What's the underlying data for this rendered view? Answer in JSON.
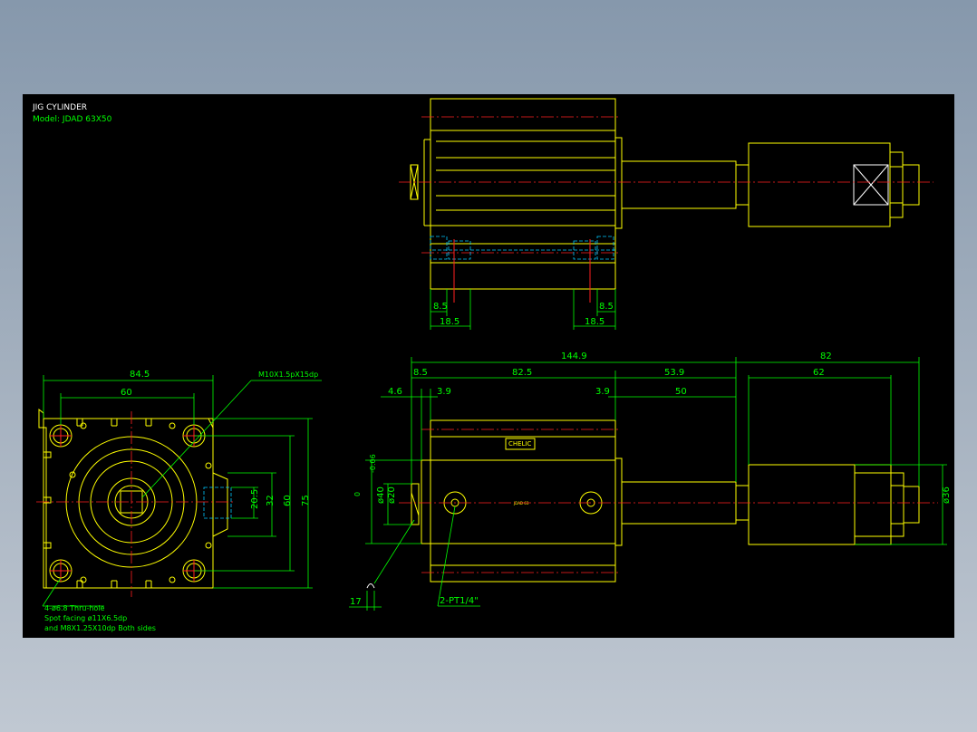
{
  "title_block": {
    "title": "JIG CYLINDER",
    "model": "Model: JDAD 63X50"
  },
  "colors": {
    "background": "#000000",
    "outline": "#ffff00",
    "dimension": "#00ff00",
    "centerline": "#ff2020",
    "hidden": "#00c8ff"
  },
  "top_view": {
    "dims": [
      "8.5",
      "18.5",
      "8.5",
      "18.5"
    ]
  },
  "end_view": {
    "dims": [
      "84.5",
      "60",
      "20.5",
      "32",
      "60",
      "75"
    ],
    "callout_thread": "M10X1.5pX15dp",
    "note_1": "4-ø6.8  Thru-hole",
    "note_2": "Spot facing  ø11X6.5dp",
    "note_3": "and M8X1.25X10dp Both sides"
  },
  "side_view": {
    "overall": "144.9",
    "rod_ext": "82",
    "d_8_5": "8.5",
    "d_82_5": "82.5",
    "d_53_9": "53.9",
    "d_62": "62",
    "d_4_6": "4.6",
    "d_3_9a": "3.9",
    "d_3_9b": "3.9",
    "d_50": "50",
    "dia_40": "ø40",
    "tol": "-0.06",
    "tol_zero": "0",
    "dia_20": "ø20",
    "dia_36": "ø36",
    "d_17": "17",
    "port_label": "2-PT1/4\"",
    "label_plate": "CHELIC",
    "body_mark": "JDAD 63"
  }
}
